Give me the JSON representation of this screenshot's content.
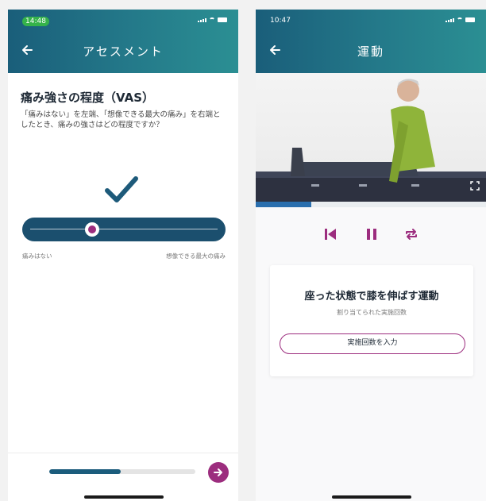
{
  "left_screen": {
    "status": {
      "time": "14:48"
    },
    "header": {
      "title": "アセスメント"
    },
    "question": {
      "title": "痛み強さの程度（VAS）",
      "text": "「痛みはない」を左端、「想像できる最大の痛み」を右端としたとき、痛みの強さはどの程度ですか？"
    },
    "scale": {
      "value": 0.33,
      "min_label": "痛みはない",
      "max_label": "想像できる最大の痛み"
    },
    "footer": {
      "progress": 0.49
    },
    "icons": [
      "back-arrow-icon",
      "check-icon",
      "next-arrow-icon"
    ]
  },
  "right_screen": {
    "status": {
      "time": "10:47"
    },
    "header": {
      "title": "運動"
    },
    "video": {
      "progress": 0.24
    },
    "controls": [
      "skip-back-icon",
      "pause-icon",
      "repeat-icon"
    ],
    "exercise": {
      "title": "座った状態で膝を伸ばす運動",
      "subtitle": "割り当てられた実施回数",
      "button_label": "実施回数を入力"
    }
  },
  "colors": {
    "header_start": "#1a5e7a",
    "header_end": "#2b8f93",
    "slider_track": "#1b4f6e",
    "accent": "#9c2d7e",
    "progress": "#1b5c7c",
    "video_progress": "#2a6fae",
    "status_time_pill": "#35b24a"
  }
}
